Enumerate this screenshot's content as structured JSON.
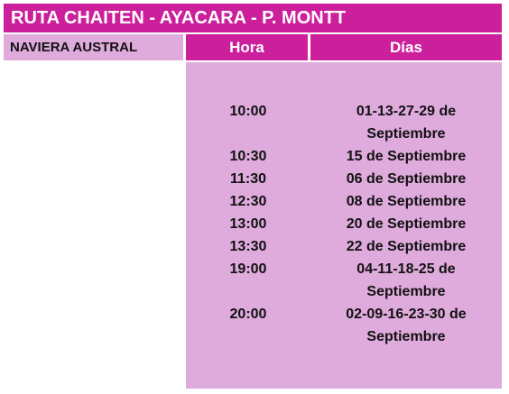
{
  "title": "RUTA CHAITEN - AYACARA - P. MONTT",
  "operator": "NAVIERA AUSTRAL",
  "columns": {
    "hora": "Hora",
    "dias": "Días"
  },
  "rows": [
    {
      "hora": "10:00",
      "dias": "01-13-27-29 de Septiembre"
    },
    {
      "hora": "10:30",
      "dias": "15 de Septiembre"
    },
    {
      "hora": "11:30",
      "dias": "06 de Septiembre"
    },
    {
      "hora": "12:30",
      "dias": "08 de Septiembre"
    },
    {
      "hora": "13:00",
      "dias": "20 de Septiembre"
    },
    {
      "hora": "13:30",
      "dias": "22 de Septiembre"
    },
    {
      "hora": "19:00",
      "dias": "04-11-18-25 de Septiembre"
    },
    {
      "hora": "20:00",
      "dias": "02-09-16-23-30 de Septiembre"
    }
  ],
  "colors": {
    "header": "#cc1f9c",
    "body": "#dfaadc"
  }
}
